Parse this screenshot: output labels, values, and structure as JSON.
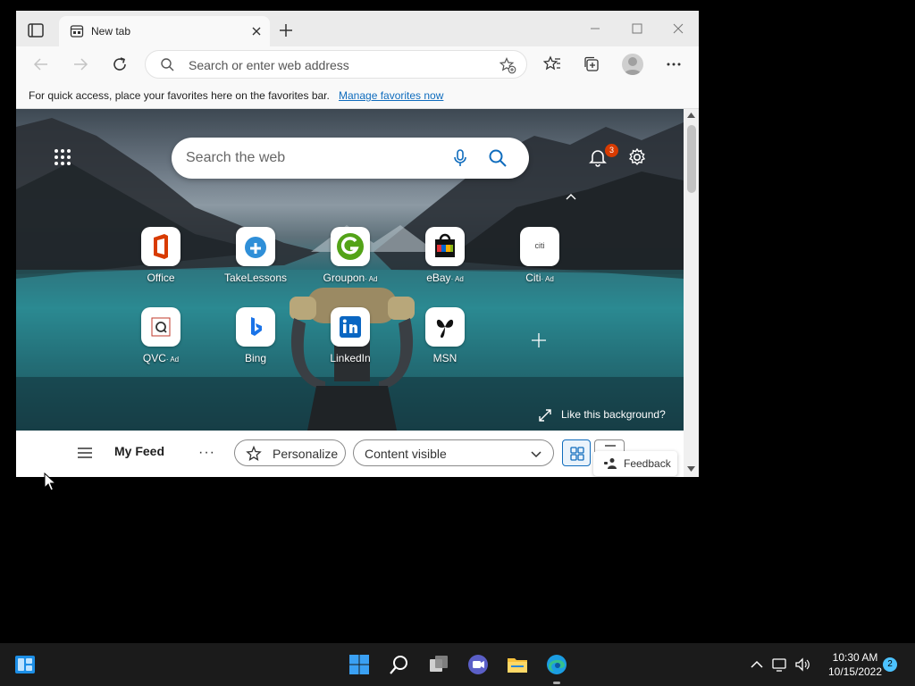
{
  "browser": {
    "tab_title": "New tab",
    "address_placeholder": "Search or enter web address",
    "favorites_bar_message": "For quick access, place your favorites here on the favorites bar.",
    "manage_favorites_link": "Manage favorites now"
  },
  "newtab": {
    "search_placeholder": "Search the web",
    "notification_count": "3",
    "quick_links": [
      {
        "label": "Office",
        "ad": ""
      },
      {
        "label": "TakeLessons",
        "ad": ""
      },
      {
        "label": "Groupon",
        "ad": "· Ad"
      },
      {
        "label": "eBay",
        "ad": "· Ad"
      },
      {
        "label": "Citi",
        "ad": "· Ad"
      },
      {
        "label": "QVC",
        "ad": "· Ad"
      },
      {
        "label": "Bing",
        "ad": ""
      },
      {
        "label": "LinkedIn",
        "ad": ""
      },
      {
        "label": "MSN",
        "ad": ""
      }
    ],
    "like_background": "Like this background?",
    "citi_logo_text": "citi"
  },
  "feed": {
    "title": "My Feed",
    "more": "···",
    "personalize": "Personalize",
    "content_select": "Content visible",
    "feedback": "Feedback"
  },
  "taskbar": {
    "time": "10:30 AM",
    "date": "10/15/2022",
    "notification_count": "2"
  },
  "colors": {
    "accent": "#0f6cbd",
    "badge": "#d83b01",
    "taskbar": "#1b1b1b"
  }
}
